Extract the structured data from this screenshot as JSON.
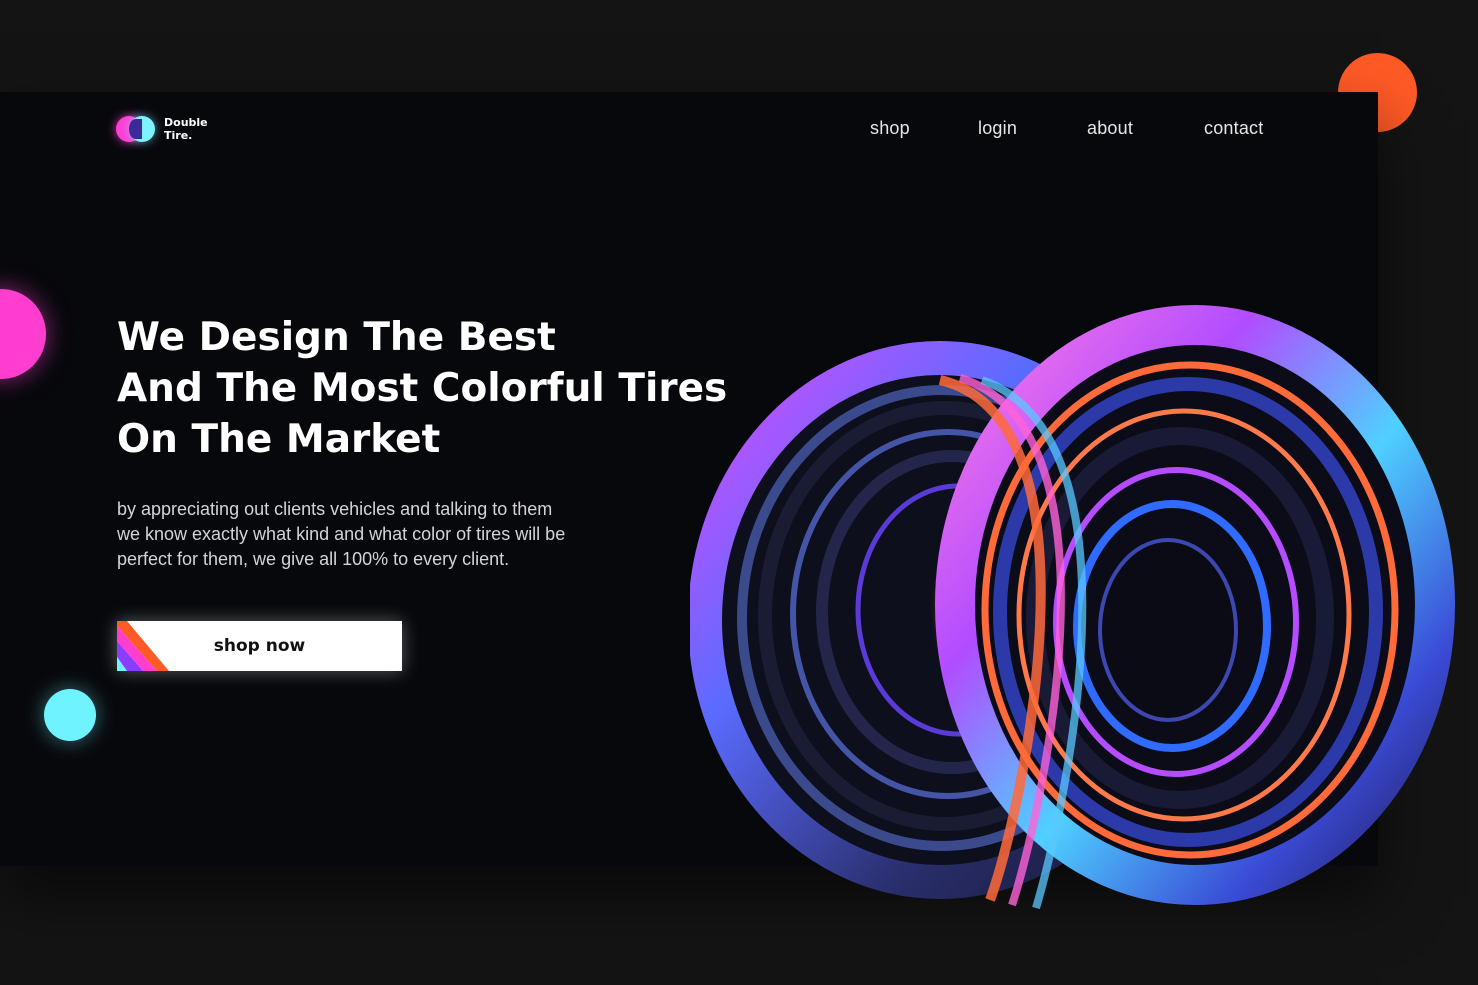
{
  "brand": {
    "line1": "Double",
    "line2": "Tire."
  },
  "nav": {
    "items": [
      {
        "label": "shop"
      },
      {
        "label": "login"
      },
      {
        "label": "about"
      },
      {
        "label": "contact"
      }
    ]
  },
  "hero": {
    "headline": [
      "We Design The Best",
      "And The Most Colorful Tires",
      "On The Market"
    ],
    "description": [
      "by appreciating out clients vehicles and talking to them",
      "we know exactly what kind and what color of tires will be",
      "perfect for them, we give all 100% to every client."
    ],
    "cta_label": "shop now"
  },
  "colors": {
    "background": "#141414",
    "panel": "#07080c",
    "accent_orange": "#ff5a26",
    "accent_pink": "#ff3ecf",
    "accent_cyan": "#6ff3ff",
    "accent_purple": "#8a3cff",
    "accent_blue": "#2f6bff"
  },
  "icons": {
    "logo": "overlapping-circles-logo-icon",
    "artwork": "twisted-tire-artwork"
  }
}
